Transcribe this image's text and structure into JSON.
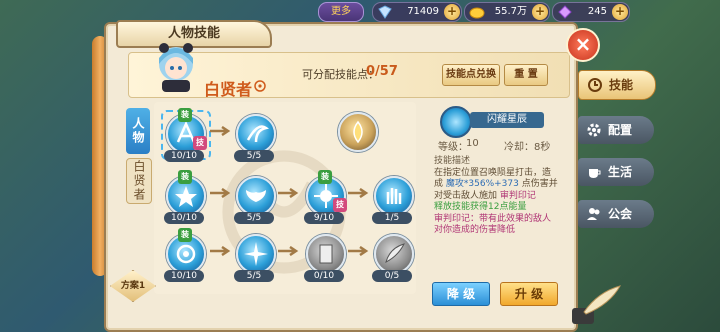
{
  "topbar": {
    "more_label": "更多",
    "currencies": [
      {
        "name": "crystal",
        "value": "71409",
        "icon": "crystal-icon"
      },
      {
        "name": "gold",
        "value": "55.7万",
        "icon": "gold-icon"
      },
      {
        "name": "gem",
        "value": "245",
        "icon": "gem-icon"
      }
    ]
  },
  "panel": {
    "title": "人物技能",
    "character_name": "白贤者",
    "points_label": "可分配技能点：",
    "points_value": "0/57",
    "exchange_label": "技能点兑换",
    "reset_label": "重 置",
    "side_tabs": [
      "人物",
      "白贤者"
    ],
    "plan_label": "方案1"
  },
  "skills": {
    "row1": [
      {
        "level": "10/10",
        "badges": [
          "装",
          "技"
        ]
      },
      {
        "level": "5/5",
        "badges": []
      },
      {
        "level": "",
        "badges": [],
        "style": "gold"
      }
    ],
    "row2": [
      {
        "level": "10/10",
        "badges": [
          "装"
        ]
      },
      {
        "level": "5/5",
        "badges": []
      },
      {
        "level": "9/10",
        "badges": [
          "装",
          "技"
        ]
      },
      {
        "level": "1/5",
        "badges": []
      }
    ],
    "row3": [
      {
        "level": "10/10",
        "badges": [
          "装"
        ]
      },
      {
        "level": "5/5",
        "badges": []
      },
      {
        "level": "0/10",
        "badges": [],
        "style": "gray"
      },
      {
        "level": "0/5",
        "badges": [],
        "style": "gray"
      }
    ]
  },
  "detail": {
    "skill_name": "闪耀星辰",
    "level_label": "等级：",
    "level_value": "10",
    "cooldown_label": "冷却：",
    "cooldown_value": "8秒",
    "desc_title": "技能描述",
    "desc_1": "在指定位置召唤陨星打击，造成",
    "desc_2": "魔攻*356%+373",
    "desc_3": "点伤害并对受击敌人施加",
    "desc_4": "审判印记",
    "desc_5": "释放技能获得12点能量",
    "desc_6": "审判印记：带有此效果的敌人对你造成的伤害降低",
    "downgrade_label": "降 级",
    "upgrade_label": "升 级"
  },
  "right_tabs": [
    {
      "label": "技能",
      "icon": "skill-icon"
    },
    {
      "label": "配置",
      "icon": "gear-icon"
    },
    {
      "label": "生活",
      "icon": "cup-icon"
    },
    {
      "label": "公会",
      "icon": "guild-icon"
    }
  ],
  "colors": {
    "accent_orange": "#cf5b1c",
    "skill_blue": "#2c9fd8",
    "panel_bg": "#f3ead6"
  }
}
